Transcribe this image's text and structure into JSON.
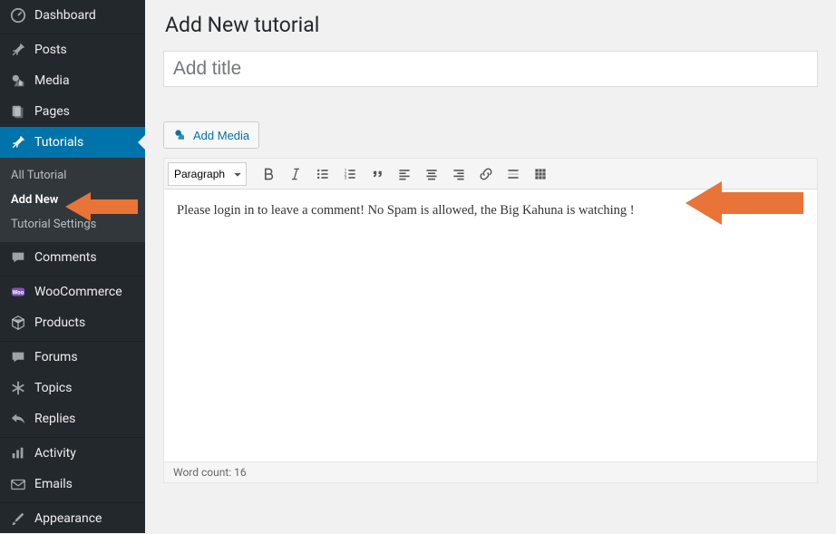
{
  "sidebar": {
    "items": [
      {
        "label": "Dashboard"
      },
      {
        "label": "Posts"
      },
      {
        "label": "Media"
      },
      {
        "label": "Pages"
      },
      {
        "label": "Tutorials"
      },
      {
        "label": "Comments"
      },
      {
        "label": "WooCommerce"
      },
      {
        "label": "Products"
      },
      {
        "label": "Forums"
      },
      {
        "label": "Topics"
      },
      {
        "label": "Replies"
      },
      {
        "label": "Activity"
      },
      {
        "label": "Emails"
      },
      {
        "label": "Appearance"
      }
    ],
    "tutorials_submenu": {
      "all": "All Tutorial",
      "add_new": "Add New",
      "settings": "Tutorial Settings"
    }
  },
  "main": {
    "page_title": "Add New tutorial",
    "title_placeholder": "Add title",
    "add_media_label": "Add Media",
    "format_value": "Paragraph",
    "content_text": "Please login in to leave a comment! No Spam is allowed, the Big Kahuna is watching !",
    "word_count_label": "Word count: 16"
  }
}
